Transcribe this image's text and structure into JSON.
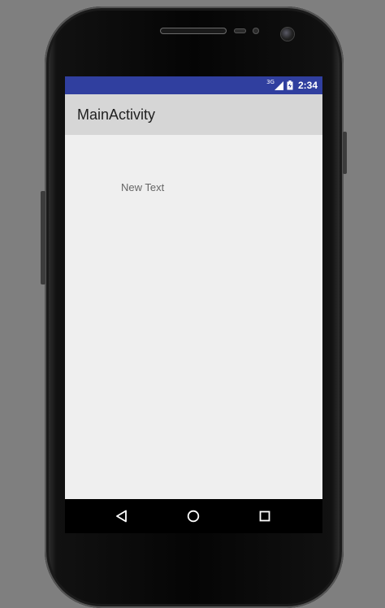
{
  "device": {
    "icons": [
      "speaker-grille-icon",
      "proximity-sensor-icon",
      "front-camera-icon"
    ]
  },
  "status_bar": {
    "background": "#303f9f",
    "network_label": "3G",
    "time": "2:34",
    "icons": [
      "signal-icon",
      "battery-charging-icon"
    ]
  },
  "app_bar": {
    "title": "MainActivity",
    "background": "#d6d6d6"
  },
  "content": {
    "text_view": "New Text",
    "background": "#efefef"
  },
  "nav_bar": {
    "buttons": [
      "back-icon",
      "home-icon",
      "recents-icon"
    ]
  }
}
